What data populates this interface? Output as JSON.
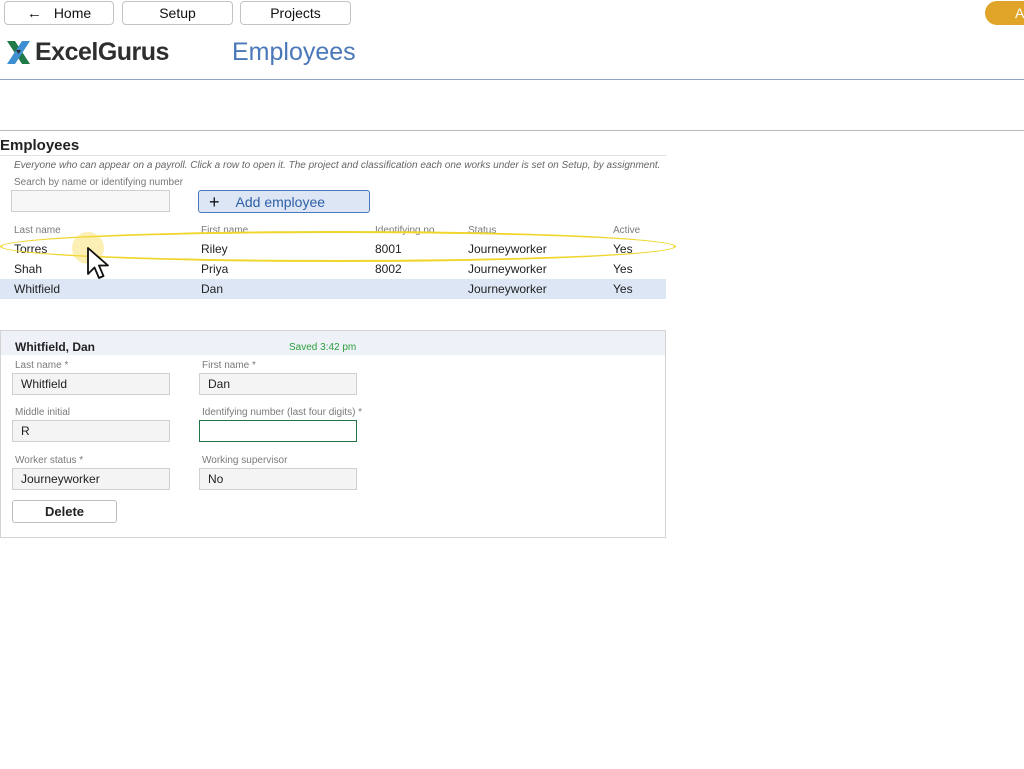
{
  "nav": {
    "home_label": "Home",
    "setup_label": "Setup",
    "projects_label": "Projects",
    "right_pill_label": "A"
  },
  "brand": {
    "logo_text": "ExcelGurus",
    "logo_icon": "x-logo-icon"
  },
  "page": {
    "title": "Employees"
  },
  "section": {
    "title": "Employees",
    "description": "Everyone who can appear on a payroll. Click a row to open it. The project and classification each one works under is set on Setup, by assignment."
  },
  "search": {
    "label": "Search by name or identifying number",
    "value": ""
  },
  "add_button": {
    "label": "Add employee",
    "icon": "plus-icon"
  },
  "table": {
    "headers": [
      "Last name",
      "First name",
      "Identifying no.",
      "Status",
      "Active"
    ],
    "rows": [
      {
        "last": "Torres",
        "first": "Riley",
        "id": "8001",
        "status": "Journeyworker",
        "active": "Yes"
      },
      {
        "last": "Shah",
        "first": "Priya",
        "id": "8002",
        "status": "Journeyworker",
        "active": "Yes"
      },
      {
        "last": "Whitfield",
        "first": "Dan",
        "id": "",
        "status": "Journeyworker",
        "active": "Yes"
      }
    ]
  },
  "detail": {
    "name": "Whitfield, Dan",
    "saved_text": "Saved 3:42 pm",
    "fields": {
      "last_name": {
        "label": "Last name *",
        "value": "Whitfield"
      },
      "first_name": {
        "label": "First name *",
        "value": "Dan"
      },
      "middle_initial": {
        "label": "Middle initial",
        "value": "R"
      },
      "identifying_number": {
        "label": "Identifying number (last four digits) *",
        "value": ""
      },
      "worker_status": {
        "label": "Worker status *",
        "value": "Journeyworker"
      },
      "working_supervisor": {
        "label": "Working supervisor",
        "value": "No"
      }
    },
    "delete_label": "Delete"
  },
  "colors": {
    "accent_blue": "#4a78b8",
    "selected_row": "#dce6f4",
    "highlight_yellow": "#f0d52a",
    "saved_green": "#2a9d3a",
    "pill_orange": "#e0a528"
  }
}
